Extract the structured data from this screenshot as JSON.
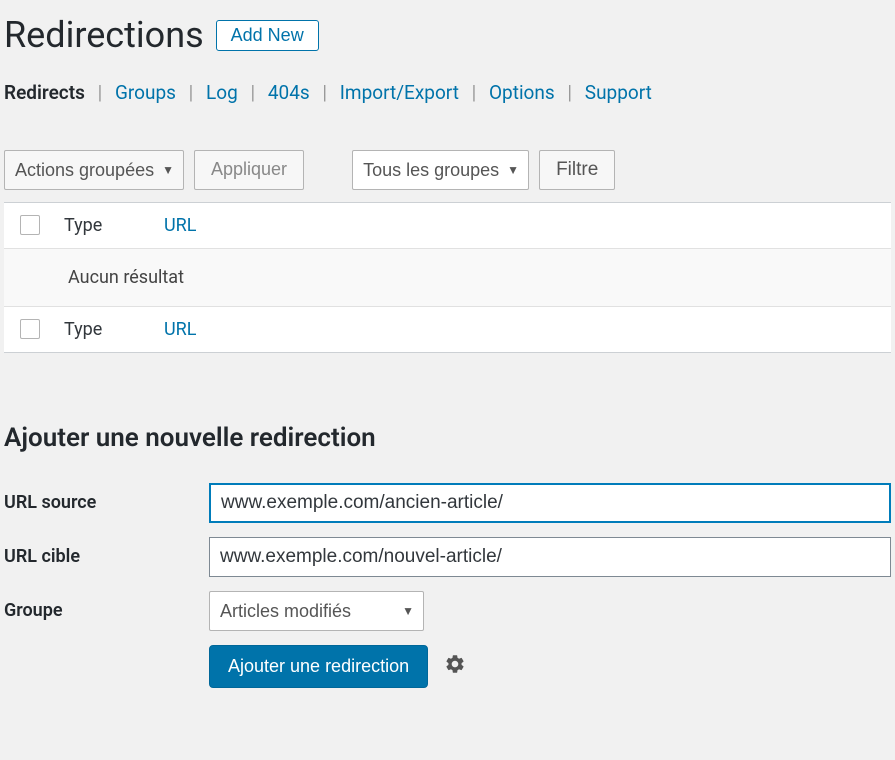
{
  "header": {
    "title": "Redirections",
    "add_new_label": "Add New"
  },
  "nav": {
    "current": "Redirects",
    "links": [
      "Groups",
      "Log",
      "404s",
      "Import/Export",
      "Options",
      "Support"
    ]
  },
  "actions": {
    "bulk_label": "Actions groupées",
    "apply_label": "Appliquer",
    "group_filter_label": "Tous les groupes",
    "filter_label": "Filtre"
  },
  "table": {
    "col_type": "Type",
    "col_url": "URL",
    "no_results": "Aucun résultat"
  },
  "form": {
    "heading": "Ajouter une nouvelle redirection",
    "source_label": "URL source",
    "source_value": "www.exemple.com/ancien-article/",
    "target_label": "URL cible",
    "target_value": "www.exemple.com/nouvel-article/",
    "group_label": "Groupe",
    "group_value": "Articles modifiés",
    "submit_label": "Ajouter une redirection"
  }
}
